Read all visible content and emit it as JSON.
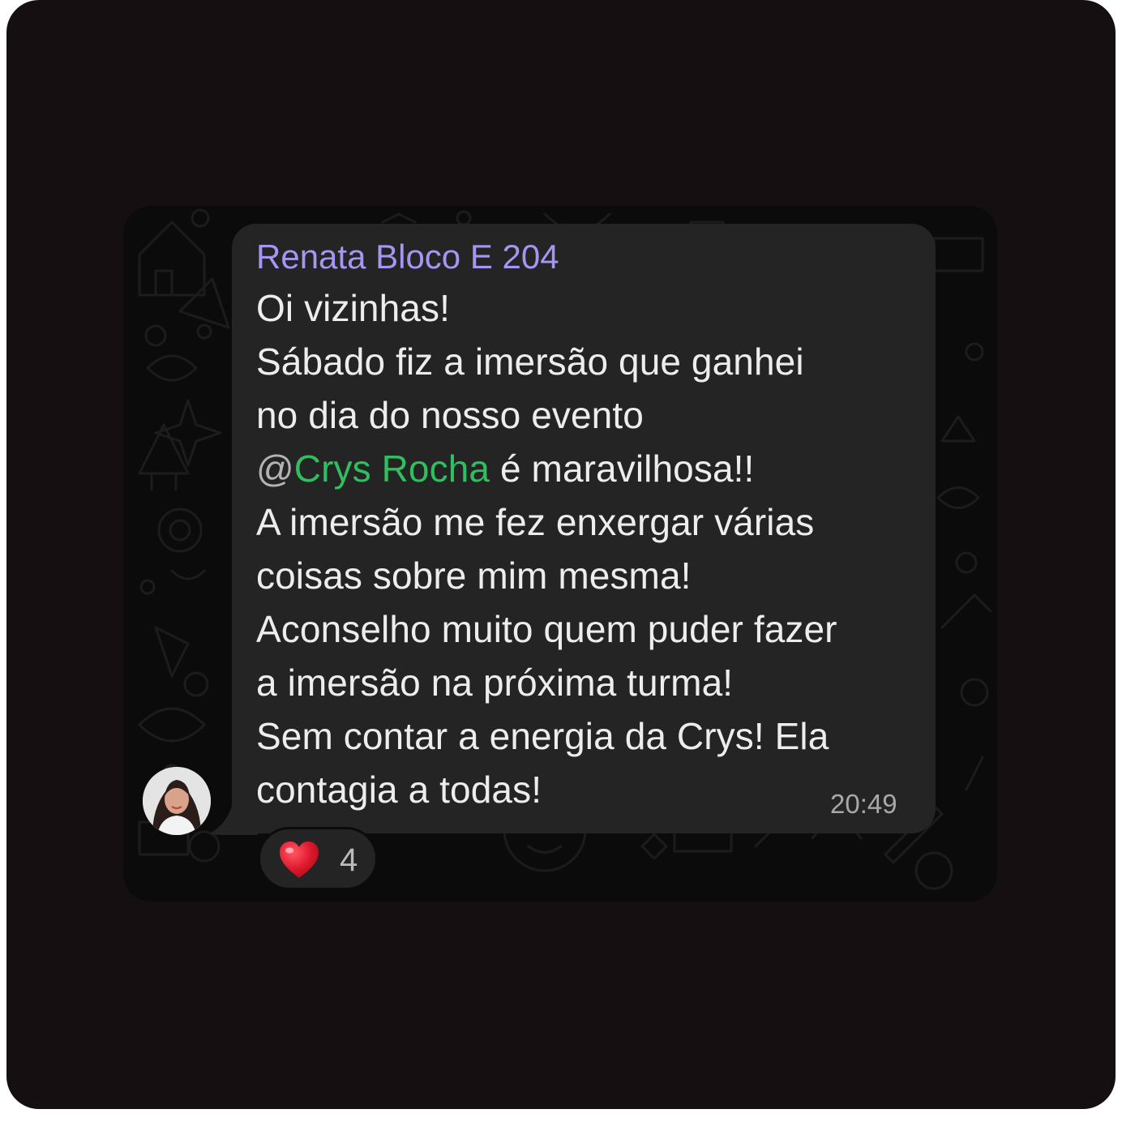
{
  "message": {
    "sender": "Renata Bloco E 204",
    "lines": {
      "l1": "Oi vizinhas!",
      "l2": "Sábado fiz a imersão que ganhei",
      "l3": "no dia do nosso evento",
      "l4_at": "@",
      "l4_mention": "Crys Rocha",
      "l4_rest": " é maravilhosa!!",
      "l5": "A imersão me fez enxergar várias",
      "l6": "coisas sobre mim mesma!",
      "l7": "Aconselho muito quem puder fazer",
      "l8": "a imersão na próxima turma!",
      "l9": "Sem contar a energia da Crys! Ela",
      "l10": "contagia a todas!"
    },
    "time": "20:49"
  },
  "reaction": {
    "emoji": "heart-emoji",
    "count": "4"
  },
  "colors": {
    "frame": "#160f11",
    "chat_background": "#0b0b0b",
    "bubble": "#242424",
    "sender_name": "#a695f3",
    "mention": "#2fbf5f",
    "text": "#ededed",
    "heart": "#e0182d"
  },
  "icons": {
    "avatar": "profile-photo",
    "background_pattern": "doodle-pattern"
  }
}
